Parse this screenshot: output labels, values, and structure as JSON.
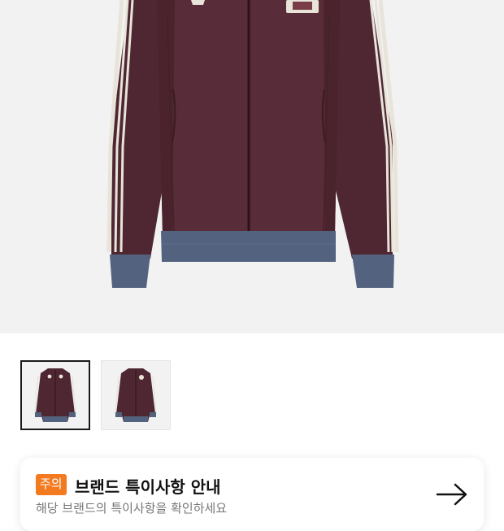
{
  "product": {
    "main_image": "jacket-front-image",
    "colors": {
      "body": "#4e2732",
      "trim": "#53637f",
      "stripe": "#e8e4da",
      "background": "#f2f2f2"
    }
  },
  "thumbnails": [
    {
      "icon": "jacket-front-thumbnail",
      "selected": true
    },
    {
      "icon": "jacket-alt-thumbnail",
      "selected": false
    }
  ],
  "notice": {
    "badge": "주의",
    "title": "브랜드 특이사항 안내",
    "subtitle": "해당 브랜드의 특이사항을 확인하세요",
    "icon": "arrow-right-icon",
    "accent": "#f47a20"
  }
}
